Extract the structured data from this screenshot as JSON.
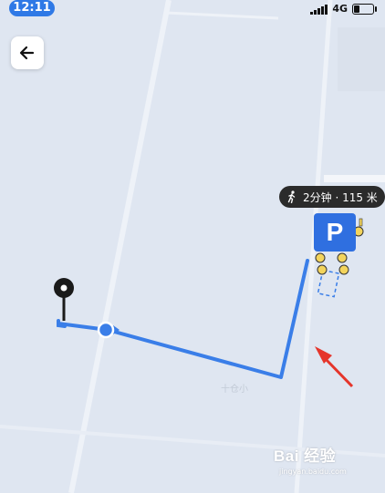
{
  "status_bar": {
    "time": "12:11",
    "network": "4G"
  },
  "navigation": {
    "back_icon": "arrow-left-icon"
  },
  "walk_info": {
    "icon": "walking-person-icon",
    "text": "2分钟 · 115 米"
  },
  "parking": {
    "label": "P"
  },
  "map": {
    "faint_label": "十仓小"
  },
  "watermark": {
    "logo": "Bai 经验",
    "url": "jingyan.baidu.com"
  },
  "colors": {
    "route": "#3a7ee8",
    "map_bg": "#dfe6f1",
    "arrow": "#e5352b",
    "badge_bg": "#2b2b2b",
    "parking": "#2f6fe0",
    "bike": "#f3d45c"
  }
}
